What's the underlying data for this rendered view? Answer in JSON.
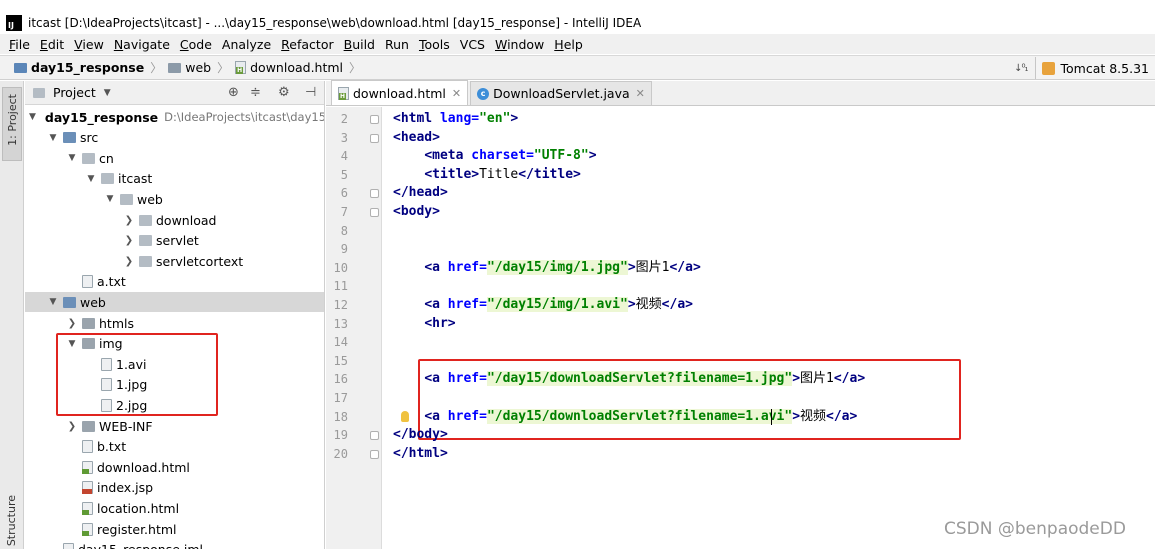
{
  "window": {
    "title": "itcast [D:\\IdeaProjects\\itcast] - ...\\day15_response\\web\\download.html [day15_response] - IntelliJ IDEA",
    "logo_text": "IJ"
  },
  "menu": {
    "items": [
      {
        "label": "File",
        "mn": "F",
        "rest": "ile"
      },
      {
        "label": "Edit",
        "mn": "E",
        "rest": "dit"
      },
      {
        "label": "View",
        "mn": "V",
        "rest": "iew"
      },
      {
        "label": "Navigate",
        "mn": "N",
        "rest": "avigate"
      },
      {
        "label": "Code",
        "mn": "C",
        "rest": "ode"
      },
      {
        "label": "Analyze",
        "mn": "",
        "rest": "Analyze"
      },
      {
        "label": "Refactor",
        "mn": "R",
        "rest": "efactor"
      },
      {
        "label": "Build",
        "mn": "B",
        "rest": "uild"
      },
      {
        "label": "Run",
        "mn": "",
        "rest": "Run"
      },
      {
        "label": "Tools",
        "mn": "T",
        "rest": "ools"
      },
      {
        "label": "VCS",
        "mn": "",
        "rest": "VCS"
      },
      {
        "label": "Window",
        "mn": "W",
        "rest": "indow"
      },
      {
        "label": "Help",
        "mn": "H",
        "rest": "elp"
      }
    ]
  },
  "navbar": {
    "crumbs": [
      "day15_response",
      "web",
      "download.html"
    ],
    "sort_icon": "↓⁰₁",
    "run_config": "Tomcat 8.5.31"
  },
  "left_strip": {
    "project_tab": "1: Project",
    "structure_tab": "Structure"
  },
  "project_panel": {
    "title": "Project",
    "tree": [
      {
        "label": "day15_response",
        "depth": 0,
        "arrow": "open",
        "icon": "folder",
        "bold": true,
        "path": "D:\\IdeaProjects\\itcast\\day15"
      },
      {
        "label": "src",
        "depth": 1,
        "arrow": "open",
        "icon": "src"
      },
      {
        "label": "cn",
        "depth": 2,
        "arrow": "open",
        "icon": "pkg"
      },
      {
        "label": "itcast",
        "depth": 3,
        "arrow": "open",
        "icon": "pkg"
      },
      {
        "label": "web",
        "depth": 4,
        "arrow": "open",
        "icon": "pkg"
      },
      {
        "label": "download",
        "depth": 5,
        "arrow": "closed",
        "icon": "pkg"
      },
      {
        "label": "servlet",
        "depth": 5,
        "arrow": "closed",
        "icon": "pkg"
      },
      {
        "label": "servletcortext",
        "depth": 5,
        "arrow": "closed",
        "icon": "pkg"
      },
      {
        "label": "a.txt",
        "depth": 2,
        "arrow": "none",
        "icon": "file"
      },
      {
        "label": "web",
        "depth": 1,
        "arrow": "open",
        "icon": "web",
        "selected": true
      },
      {
        "label": "htmls",
        "depth": 2,
        "arrow": "closed",
        "icon": "folder"
      },
      {
        "label": "img",
        "depth": 2,
        "arrow": "open",
        "icon": "folder"
      },
      {
        "label": "1.avi",
        "depth": 3,
        "arrow": "none",
        "icon": "file"
      },
      {
        "label": "1.jpg",
        "depth": 3,
        "arrow": "none",
        "icon": "file"
      },
      {
        "label": "2.jpg",
        "depth": 3,
        "arrow": "none",
        "icon": "file"
      },
      {
        "label": "WEB-INF",
        "depth": 2,
        "arrow": "closed",
        "icon": "folder"
      },
      {
        "label": "b.txt",
        "depth": 2,
        "arrow": "none",
        "icon": "file"
      },
      {
        "label": "download.html",
        "depth": 2,
        "arrow": "none",
        "icon": "html"
      },
      {
        "label": "index.jsp",
        "depth": 2,
        "arrow": "none",
        "icon": "jsp"
      },
      {
        "label": "location.html",
        "depth": 2,
        "arrow": "none",
        "icon": "html"
      },
      {
        "label": "register.html",
        "depth": 2,
        "arrow": "none",
        "icon": "html"
      },
      {
        "label": "day15_response.iml",
        "depth": 1,
        "arrow": "none",
        "icon": "file"
      }
    ]
  },
  "editor": {
    "tabs": [
      {
        "label": "download.html",
        "active": true,
        "icon": "html"
      },
      {
        "label": "DownloadServlet.java",
        "active": false,
        "icon": "java"
      }
    ],
    "lines": [
      {
        "n": "2",
        "fold": true,
        "parts": [
          [
            "tag",
            "<html "
          ],
          [
            "attr",
            "lang="
          ],
          [
            "val",
            "\"en\""
          ],
          [
            "tag",
            ">"
          ]
        ]
      },
      {
        "n": "3",
        "fold": true,
        "parts": [
          [
            "tag",
            "<head>"
          ]
        ]
      },
      {
        "n": "4",
        "fold": false,
        "parts": [
          [
            "t",
            "    "
          ],
          [
            "tag",
            "<meta "
          ],
          [
            "attr",
            "charset="
          ],
          [
            "val",
            "\"UTF-8\""
          ],
          [
            "tag",
            ">"
          ]
        ]
      },
      {
        "n": "5",
        "fold": false,
        "parts": [
          [
            "t",
            "    "
          ],
          [
            "tag",
            "<title>"
          ],
          [
            "t",
            "Title"
          ],
          [
            "tag",
            "</title>"
          ]
        ]
      },
      {
        "n": "6",
        "fold": true,
        "parts": [
          [
            "tag",
            "</head>"
          ]
        ]
      },
      {
        "n": "7",
        "fold": true,
        "parts": [
          [
            "tag",
            "<body>"
          ]
        ]
      },
      {
        "n": "8",
        "fold": false,
        "parts": []
      },
      {
        "n": "9",
        "fold": false,
        "parts": []
      },
      {
        "n": "10",
        "fold": false,
        "parts": [
          [
            "t",
            "    "
          ],
          [
            "tag",
            "<a "
          ],
          [
            "attr",
            "href="
          ],
          [
            "valh",
            "\"/day15/img/1.jpg\""
          ],
          [
            "tag",
            ">"
          ],
          [
            "t",
            "图片1"
          ],
          [
            "tag",
            "</a>"
          ]
        ]
      },
      {
        "n": "11",
        "fold": false,
        "parts": []
      },
      {
        "n": "12",
        "fold": false,
        "parts": [
          [
            "t",
            "    "
          ],
          [
            "tag",
            "<a "
          ],
          [
            "attr",
            "href="
          ],
          [
            "valh",
            "\"/day15/img/1.avi\""
          ],
          [
            "tag",
            ">"
          ],
          [
            "t",
            "视频"
          ],
          [
            "tag",
            "</a>"
          ]
        ]
      },
      {
        "n": "13",
        "fold": false,
        "parts": [
          [
            "t",
            "    "
          ],
          [
            "tag",
            "<hr>"
          ]
        ]
      },
      {
        "n": "14",
        "fold": false,
        "parts": []
      },
      {
        "n": "15",
        "fold": false,
        "parts": []
      },
      {
        "n": "16",
        "fold": false,
        "parts": [
          [
            "t",
            "    "
          ],
          [
            "tag",
            "<a "
          ],
          [
            "attr",
            "href="
          ],
          [
            "valh",
            "\"/day15/downloadServlet?filename=1.jpg\""
          ],
          [
            "tag",
            ">"
          ],
          [
            "t",
            "图片1"
          ],
          [
            "tag",
            "</a>"
          ]
        ]
      },
      {
        "n": "17",
        "fold": false,
        "parts": []
      },
      {
        "n": "18",
        "fold": false,
        "parts": [
          [
            "t",
            "    "
          ],
          [
            "tag",
            "<a "
          ],
          [
            "attr",
            "href="
          ],
          [
            "valh",
            "\"/day15/downloadServlet?filename=1.avi\""
          ],
          [
            "tag",
            ">"
          ],
          [
            "t",
            "视频"
          ],
          [
            "tag",
            "</a>"
          ]
        ]
      },
      {
        "n": "19",
        "fold": true,
        "parts": [
          [
            "tag",
            "</body>"
          ]
        ]
      },
      {
        "n": "20",
        "fold": true,
        "parts": [
          [
            "tag",
            "</html>"
          ]
        ]
      }
    ]
  },
  "watermark": "CSDN @benpaodeDD",
  "colors": {
    "highlight_box": "#e0241f",
    "tag": "#000080",
    "attr": "#0000ff",
    "value": "#008000"
  }
}
